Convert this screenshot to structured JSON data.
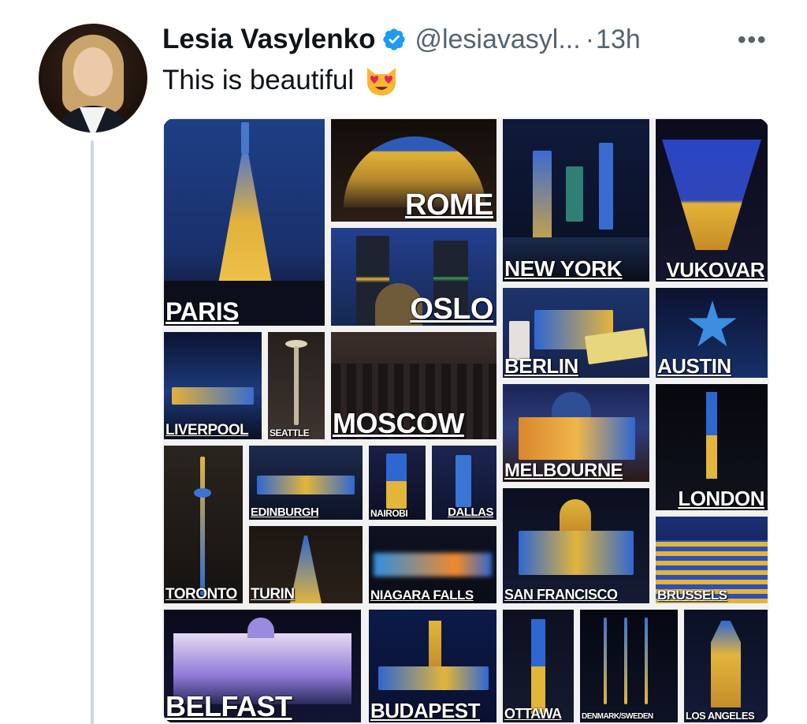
{
  "tweet": {
    "author_name": "Lesia Vasylenko",
    "author_handle": "@lesiavasyl...",
    "separator": "·",
    "time": "13h",
    "more_icon": "more-options-icon",
    "text": "This is beautiful",
    "emoji": "smiling-cat-heart-eyes-emoji",
    "verified_color": "#1d9bf0"
  },
  "image_labels": {
    "paris": "PARIS",
    "rome": "ROME",
    "new_york": "NEW YORK",
    "vukovar": "VUKOVAR",
    "oslo": "OSLO",
    "berlin": "BERLIN",
    "austin": "AUSTIN",
    "liverpool": "LIVERPOOL",
    "seattle": "SEATTLE",
    "moscow": "MOSCOW",
    "melbourne": "MELBOURNE",
    "london": "LONDON",
    "edinburgh": "EDINBURGH",
    "nairobi": "NAIROBI",
    "dallas": "DALLAS",
    "toronto": "TORONTO",
    "turin": "TURIN",
    "niagara_falls": "NIAGARA FALLS",
    "san_francisco": "SAN FRANCISCO",
    "brussels": "BRUSSELS",
    "belfast": "BELFAST",
    "budapest": "BUDAPEST",
    "ottawa": "OTTAWA",
    "denmark_sweden": "DENMARK/SWEDEN",
    "los_angeles": "LOS ANGELES"
  }
}
